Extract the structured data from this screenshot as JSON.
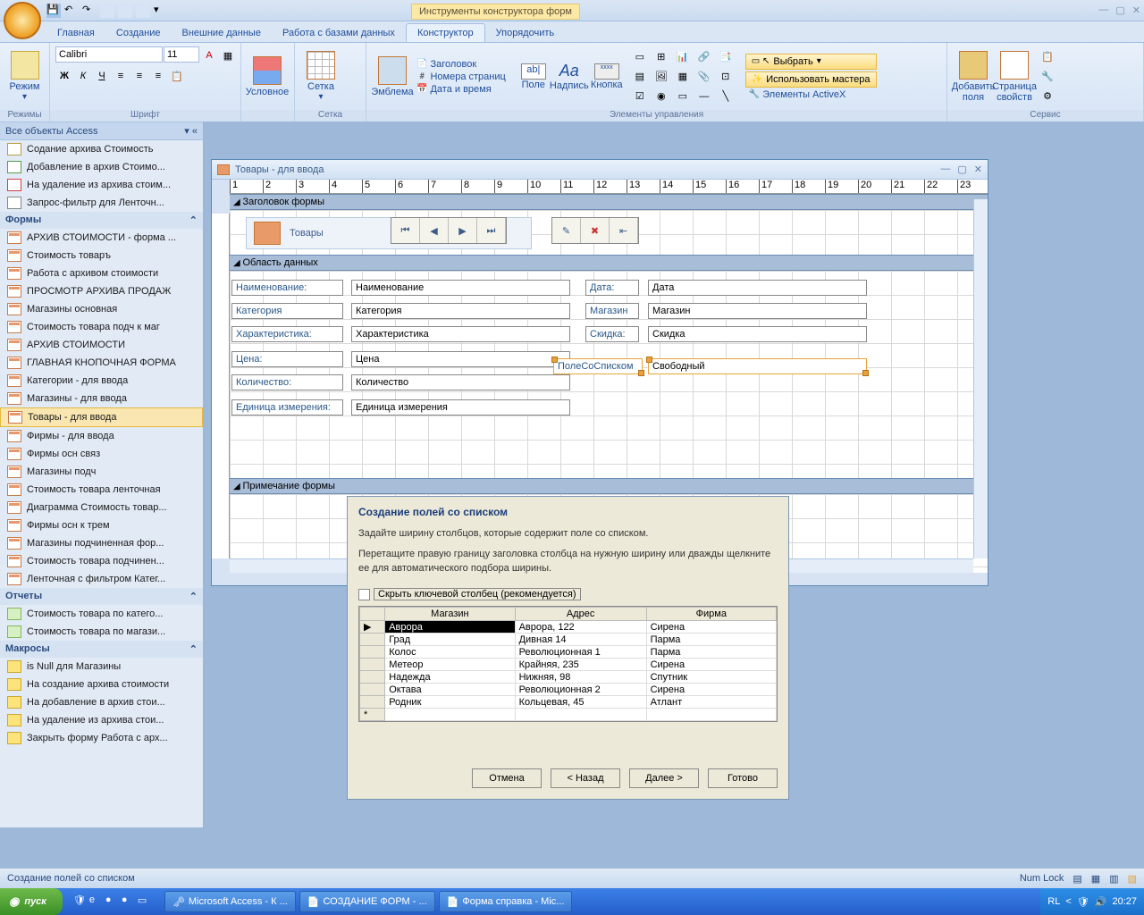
{
  "titlebar": {
    "app": "Microsoft Access",
    "context": "Инструменты конструктора форм"
  },
  "tabs": [
    "Главная",
    "Создание",
    "Внешние данные",
    "Работа с базами данных",
    "Конструктор",
    "Упорядочить"
  ],
  "ribbon": {
    "modes": {
      "label": "Режим",
      "group": "Режимы"
    },
    "font": {
      "name": "Calibri",
      "size": "11",
      "group": "Шрифт"
    },
    "cond": {
      "label": "Условное"
    },
    "grid": {
      "label": "Сетка",
      "group": "Сетка"
    },
    "emblem": {
      "label": "Эмблема"
    },
    "header_items": [
      "Заголовок",
      "Номера страниц",
      "Дата и время"
    ],
    "field": "Поле",
    "label": "Надпись",
    "button": "Кнопка",
    "controls_group": "Элементы управления",
    "select": "Выбрать",
    "wizards": "Использовать мастера",
    "activex": "Элементы ActiveX",
    "addfields": "Добавить\nполя",
    "props": "Страница\nсвойств",
    "service": "Сервис"
  },
  "nav": {
    "header": "Все объекты Access",
    "queries": [
      "Содание архива Стоимость",
      "Добавление в архив Стоимо...",
      "На удаление из архива стоим...",
      "Запрос-фильтр для Ленточн..."
    ],
    "forms_h": "Формы",
    "forms": [
      "АРХИВ СТОИМОСТИ - форма ...",
      "Стоимость товаръ",
      "Работа с архивом стоимости",
      "ПРОСМОТР АРХИВА ПРОДАЖ",
      "Магазины основная",
      "Стоимость товара подч к маг",
      "АРХИВ СТОИМОСТИ",
      "ГЛАВНАЯ КНОПОЧНАЯ ФОРМА",
      "Категории - для ввода",
      "Магазины - для ввода",
      "Товары - для ввода",
      "Фирмы - для ввода",
      "Фирмы осн связ",
      "Магазины подч",
      "Стоимость товара ленточная",
      "Диаграмма Стоимость товар...",
      "Фирмы осн к трем",
      "Магазины подчиненная фор...",
      "Стоимость товара подчинен...",
      "Ленточная с фильтром Катег..."
    ],
    "selected_form": "Товары - для ввода",
    "reports_h": "Отчеты",
    "reports": [
      "Стоимость товара по катего...",
      "Стоимость товара по магази..."
    ],
    "macros_h": "Макросы",
    "macros": [
      "is Null для Магазины",
      "На создание архива стоимости",
      "На добавление в архив стои...",
      "На удаление из архива стои...",
      "Закрыть форму Работа с арх..."
    ]
  },
  "formwin": {
    "title": "Товары - для ввода",
    "sections": {
      "header": "Заголовок формы",
      "detail": "Область данных",
      "footer": "Примечание формы"
    },
    "form_title": "Товары",
    "labels": {
      "name": "Наименование:",
      "cat": "Категория",
      "char": "Характеристика:",
      "price": "Цена:",
      "qty": "Количество:",
      "unit": "Единица измерения:",
      "date": "Дата:",
      "shop": "Магазин",
      "disc": "Скидка:",
      "combo": "ПолеСоСписком"
    },
    "fields": {
      "name": "Наименование",
      "cat": "Категория",
      "char": "Характеристика",
      "price": "Цена",
      "qty": "Количество",
      "unit": "Единица измерения",
      "date": "Дата",
      "shop": "Магазин",
      "disc": "Скидка",
      "combo": "Свободный"
    }
  },
  "wizard": {
    "title": "Создание полей со списком",
    "text1": "Задайте ширину столбцов, которые содержит поле со списком.",
    "text2": "Перетащите правую границу заголовка столбца на нужную ширину или дважды щелкните ее для автоматического подбора ширины.",
    "hide_key": "Скрыть ключевой столбец (рекомендуется)",
    "cols": [
      "Магазин",
      "Адрес",
      "Фирма"
    ],
    "rows": [
      [
        "Аврора",
        "Аврора, 122",
        "Сирена"
      ],
      [
        "Град",
        "Дивная 14",
        "Парма"
      ],
      [
        "Колос",
        "Революционная 1",
        "Парма"
      ],
      [
        "Метеор",
        "Крайняя, 235",
        "Сирена"
      ],
      [
        "Надежда",
        "Нижняя, 98",
        "Спутник"
      ],
      [
        "Октава",
        "Революционная 2",
        "Сирена"
      ],
      [
        "Родник",
        "Кольцевая, 45",
        "Атлант"
      ]
    ],
    "btns": {
      "cancel": "Отмена",
      "back": "< Назад",
      "next": "Далее >",
      "finish": "Готово"
    }
  },
  "status": {
    "left": "Создание полей со списком",
    "numlock": "Num Lock"
  },
  "taskbar": {
    "start": "пуск",
    "items": [
      "Microsoft Access - К ...",
      "СОЗДАНИЕ ФОРМ - ...",
      "Форма справка - Mic..."
    ],
    "lang": "RL",
    "time": "20:27"
  }
}
